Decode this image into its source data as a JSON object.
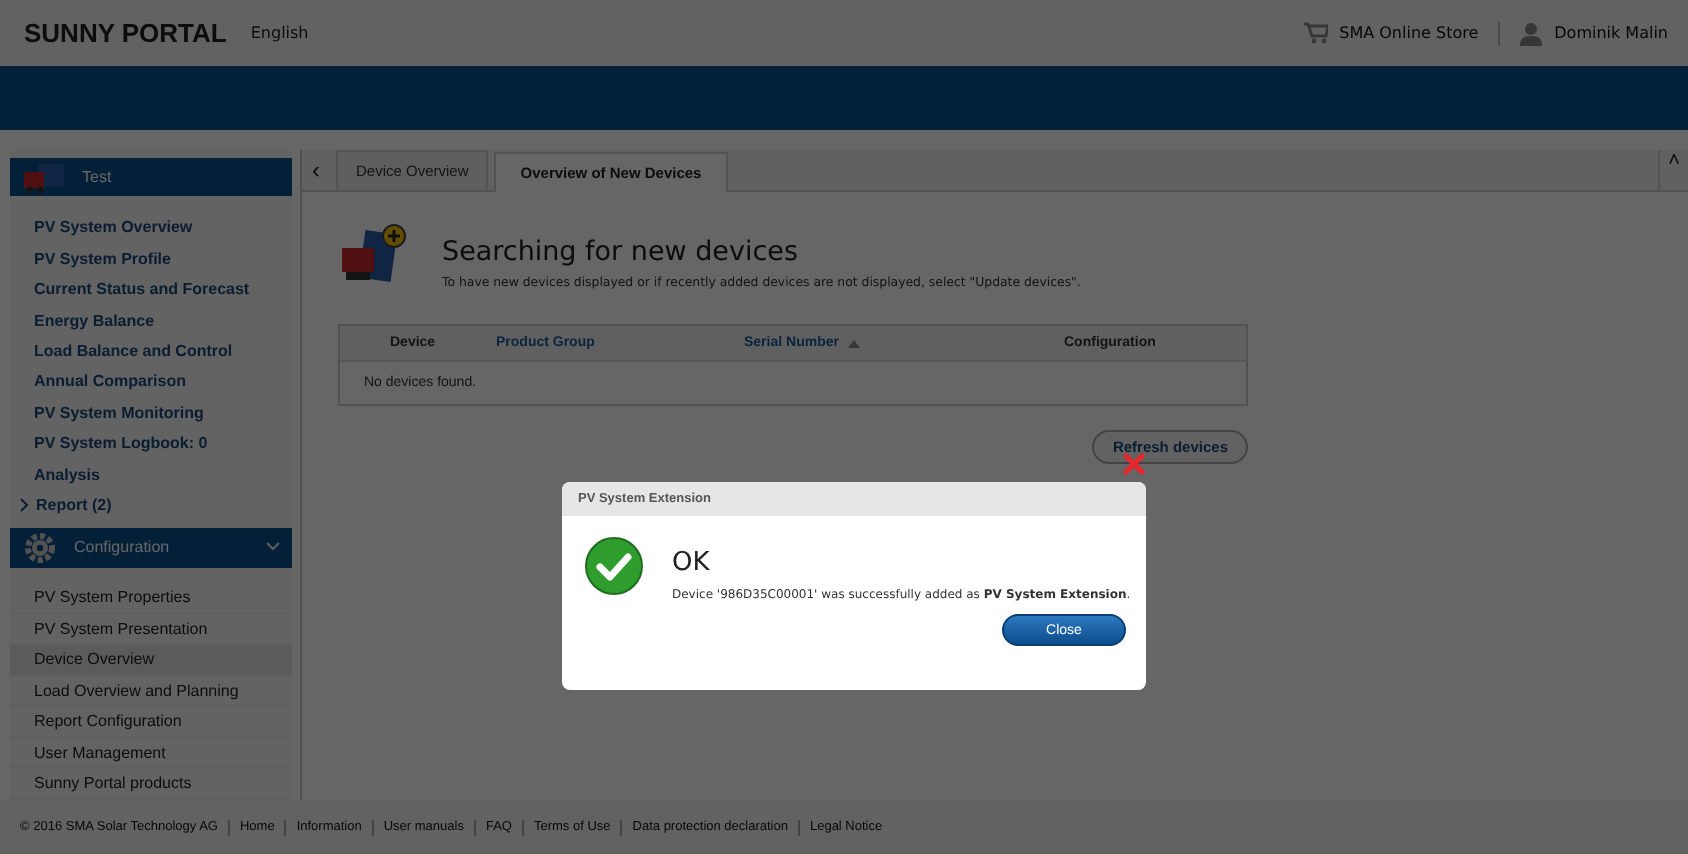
{
  "header": {
    "logo": "SUNNY PORTAL",
    "language": "English",
    "store": "SMA Online Store",
    "user": "Dominik Malin"
  },
  "sidebar": {
    "groups": [
      {
        "label": "Test",
        "kind": "plant",
        "items": [
          {
            "label": "PV System Overview",
            "selected": false
          },
          {
            "label": "PV System Profile",
            "selected": false
          },
          {
            "label": "Current Status and Forecast",
            "selected": false
          },
          {
            "label": "Energy Balance",
            "selected": false
          },
          {
            "label": "Load Balance and Control",
            "selected": false
          },
          {
            "label": "Annual Comparison",
            "selected": false
          },
          {
            "label": "PV System Monitoring",
            "selected": false
          },
          {
            "label": "PV System Logbook: 0",
            "selected": false
          },
          {
            "label": "Analysis",
            "selected": false
          },
          {
            "label": "Report (2)",
            "selected": false,
            "expanded": false
          }
        ]
      },
      {
        "label": "Configuration",
        "kind": "settings",
        "expanded": true,
        "items": [
          {
            "label": "PV System Properties",
            "selected": false
          },
          {
            "label": "PV System Presentation",
            "selected": false
          },
          {
            "label": "Device Overview",
            "selected": true
          },
          {
            "label": "Load Overview and Planning",
            "selected": false
          },
          {
            "label": "Report Configuration",
            "selected": false
          },
          {
            "label": "User Management",
            "selected": false
          },
          {
            "label": "Sunny Portal products",
            "selected": false
          }
        ]
      }
    ]
  },
  "tab_nav": {
    "previous": "‹",
    "collapse": "˄"
  },
  "tabs": [
    {
      "label": "Device Overview",
      "selected": false
    },
    {
      "label": "Overview of New Devices",
      "selected": true
    }
  ],
  "content": {
    "title": "Searching for new devices",
    "description": "To have new devices displayed or if recently added devices are not displayed, select \"Update devices\".",
    "table": {
      "columns": [
        {
          "label": "Device",
          "sortable": false,
          "sorted": false
        },
        {
          "label": "Product Group",
          "sortable": true,
          "sorted": false
        },
        {
          "label": "Serial Number",
          "sortable": true,
          "sorted": true
        },
        {
          "label": "Configuration",
          "sortable": false,
          "sorted": false
        }
      ],
      "empty_message": "No devices found."
    },
    "refresh_button": "Refresh devices"
  },
  "footer": {
    "links": [
      "© 2016 SMA Solar Technology AG",
      "Home",
      "Information",
      "User manuals",
      "FAQ",
      "Terms of Use",
      "Data protection declaration",
      "Legal Notice"
    ]
  },
  "dialog": {
    "title": "PV System Extension",
    "heading": "OK",
    "message": "Device '986D35C00001' was successfully added as **PV System Extension**.",
    "button": "Close"
  }
}
